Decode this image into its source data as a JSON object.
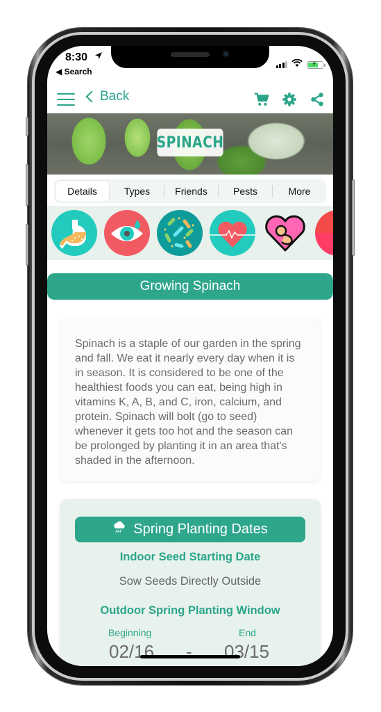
{
  "status_bar": {
    "time": "8:30",
    "location_icon": "location-arrow-icon",
    "back_app": "Search",
    "icons": [
      "cellular-signal-icon",
      "wifi-icon",
      "battery-charging-icon"
    ]
  },
  "nav": {
    "menu_icon": "hamburger-menu-icon",
    "back_label": "Back",
    "actions": [
      {
        "name": "cart",
        "icon": "shopping-cart-icon"
      },
      {
        "name": "settings",
        "icon": "gear-icon"
      },
      {
        "name": "share",
        "icon": "share-icon"
      }
    ]
  },
  "hero": {
    "title": "SPINACH"
  },
  "tabs": [
    {
      "label": "Details",
      "active": true
    },
    {
      "label": "Types",
      "active": false
    },
    {
      "label": "Friends",
      "active": false
    },
    {
      "label": "Pests",
      "active": false
    },
    {
      "label": "More",
      "active": false
    }
  ],
  "benefits": [
    {
      "name": "digestion",
      "icon": "stomach-icon"
    },
    {
      "name": "eye-health",
      "icon": "eye-icon"
    },
    {
      "name": "gut-bacteria",
      "icon": "bacteria-icon"
    },
    {
      "name": "heart-health",
      "icon": "heart-rate-icon"
    },
    {
      "name": "pregnancy",
      "icon": "fetus-heart-icon"
    },
    {
      "name": "more",
      "icon": "partial-red-icon"
    }
  ],
  "section": {
    "title": "Growing Spinach"
  },
  "description": "Spinach is a staple of our garden in the spring and fall. We eat it nearly every day when it is in season. It is considered to be one of the healthiest foods you can eat, being high in vitamins K, A, B, and C, iron, calcium, and protein. Spinach will bolt (go to seed) whenever it gets too hot and the season can be prolonged by planting it in an area that's shaded in the afternoon.",
  "planting": {
    "header_icon": "rain-cloud-icon",
    "header": "Spring Planting Dates",
    "indoor_label": "Indoor Seed Starting Date",
    "indoor_value": "Sow Seeds Directly Outside",
    "outdoor_label": "Outdoor Spring Planting Window",
    "beginning_label": "Beginning",
    "end_label": "End",
    "beginning_date": "02/16",
    "separator": "-",
    "end_date": "03/15"
  },
  "colors": {
    "accent": "#2ea68c",
    "strip_background": "#e8f1ec",
    "card_background": "#e8f2ec"
  }
}
